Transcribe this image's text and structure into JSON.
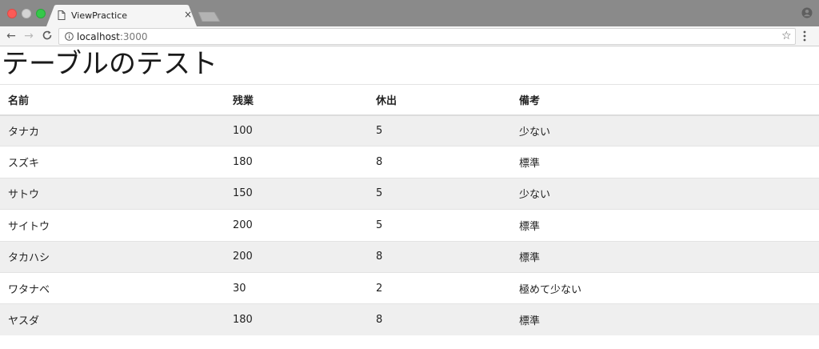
{
  "browser": {
    "tab_title": "ViewPractice",
    "tab_close": "×",
    "url_host": "localhost",
    "url_port": ":3000",
    "icons": {
      "back": "back-arrow-icon",
      "forward": "forward-arrow-icon",
      "reload": "reload-icon",
      "info": "info-icon",
      "bookmark": "star-icon",
      "menu": "kebab-menu-icon",
      "profile": "profile-icon",
      "document": "document-icon"
    },
    "glyphs": {
      "back": "←",
      "forward": "→",
      "reload": "C",
      "star": "☆"
    }
  },
  "page": {
    "title": "テーブルのテスト",
    "table": {
      "headers": [
        "名前",
        "残業",
        "休出",
        "備考"
      ],
      "rows": [
        [
          "タナカ",
          "100",
          "5",
          "少ない"
        ],
        [
          "スズキ",
          "180",
          "8",
          "標準"
        ],
        [
          "サトウ",
          "150",
          "5",
          "少ない"
        ],
        [
          "サイトウ",
          "200",
          "5",
          "標準"
        ],
        [
          "タカハシ",
          "200",
          "8",
          "標準"
        ],
        [
          "ワタナベ",
          "30",
          "2",
          "極めて少ない"
        ],
        [
          "ヤスダ",
          "180",
          "8",
          "標準"
        ]
      ]
    }
  },
  "colors": {
    "tabbar": "#8a8a8a",
    "toolbar": "#f5f5f5",
    "row_stripe": "#efefef",
    "traffic_close": "#fc5b57",
    "traffic_max": "#35c84a"
  }
}
